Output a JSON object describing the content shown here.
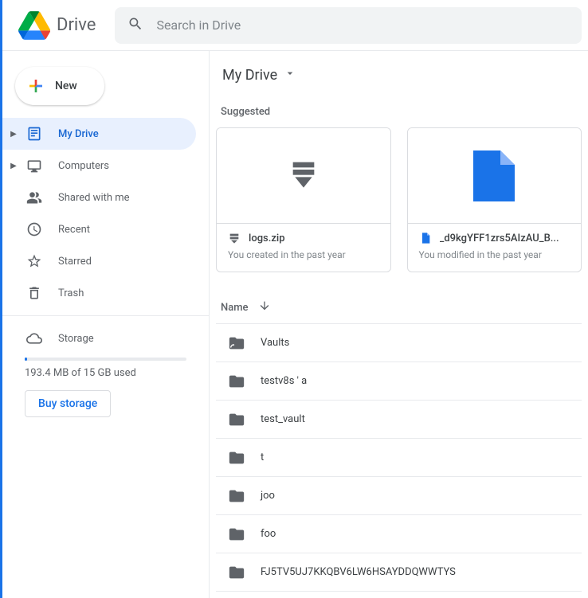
{
  "app": {
    "name": "Drive"
  },
  "search": {
    "placeholder": "Search in Drive"
  },
  "newBtn": {
    "label": "New"
  },
  "nav": {
    "myDrive": "My Drive",
    "computers": "Computers",
    "shared": "Shared with me",
    "recent": "Recent",
    "starred": "Starred",
    "trash": "Trash",
    "storage": "Storage"
  },
  "storage": {
    "text": "193.4 MB of 15 GB used",
    "buy": "Buy storage"
  },
  "breadcrumb": "My Drive",
  "sections": {
    "suggested": "Suggested",
    "name": "Name"
  },
  "suggested": [
    {
      "title": "logs.zip",
      "sub": "You created in the past year"
    },
    {
      "title": "_d9kgYFF1zrs5AIzAU_B...",
      "sub": "You modified in the past year"
    }
  ],
  "files": [
    {
      "name": "Vaults",
      "icon": "shortcut-folder"
    },
    {
      "name": "testv8s ' a",
      "icon": "folder"
    },
    {
      "name": "test_vault",
      "icon": "folder"
    },
    {
      "name": "t",
      "icon": "folder"
    },
    {
      "name": "joo",
      "icon": "folder"
    },
    {
      "name": "foo",
      "icon": "folder"
    },
    {
      "name": "FJ5TV5UJ7KKQBV6LW6HSAYDDQWWTYS",
      "icon": "folder"
    }
  ]
}
